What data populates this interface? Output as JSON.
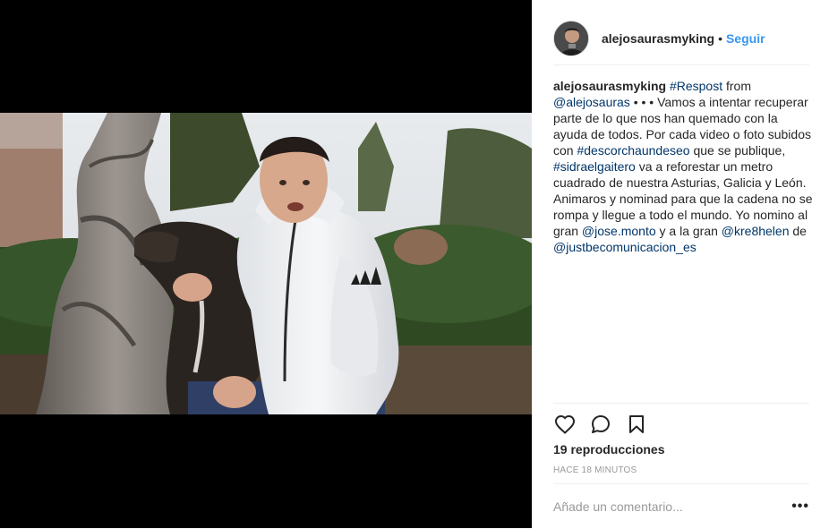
{
  "post": {
    "username": "alejosaurasmyking",
    "separator": "•",
    "follow_label": "Seguir",
    "avatar_icon": "user-avatar",
    "video_icon": "video-frame"
  },
  "caption": {
    "author": "alejosaurasmyking",
    "tag_respost": "#Respost",
    "t1": " from ",
    "mention_alejosauras": "@alejosauras",
    "t2": " • • • Vamos a intentar recuperar parte de lo que nos han quemado con la ayuda de todos. Por cada video o foto subidos con ",
    "tag_descorcha": "#descorchaundeseo",
    "t3": " que se publique, ",
    "tag_sidra": "#sidraelgaitero",
    "t4": " va a reforestar un metro cuadrado de nuestra Asturias, Galicia y León. Animaros y nominad para que la cadena no se rompa y llegue a todo el mundo. Yo nomino al gran ",
    "mention_jose": "@jose.monto",
    "t5": " y a la gran ",
    "mention_kre": "@kre8helen",
    "t6": " de ",
    "mention_just": "@justbecomunicacion_es"
  },
  "actions": {
    "like_icon": "heart-icon",
    "comment_icon": "comment-icon",
    "save_icon": "bookmark-icon"
  },
  "stats": {
    "views": "19 reproducciones",
    "time": "HACE 18 MINUTOS"
  },
  "comment": {
    "placeholder": "Añade un comentario...",
    "more_label": "•••"
  },
  "colors": {
    "link": "#003569",
    "follow": "#3897f0",
    "text": "#262626",
    "muted": "#999999",
    "divider": "#efefef"
  }
}
